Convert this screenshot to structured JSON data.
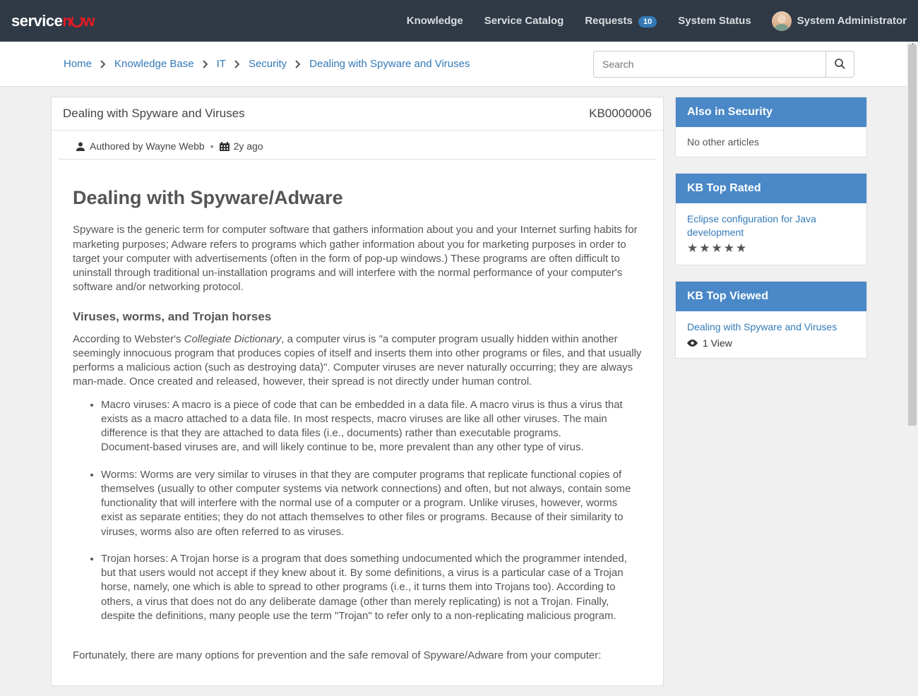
{
  "nav": {
    "knowledge": "Knowledge",
    "service_catalog": "Service Catalog",
    "requests": "Requests",
    "requests_count": "10",
    "system_status": "System Status",
    "user_name": "System Administrator"
  },
  "breadcrumb": {
    "items": [
      "Home",
      "Knowledge Base",
      "IT",
      "Security",
      "Dealing with Spyware and Viruses"
    ]
  },
  "search": {
    "placeholder": "Search"
  },
  "article": {
    "title_bar": "Dealing with Spyware and Viruses",
    "kb_id": "KB0000006",
    "author_line": "Authored by Wayne Webb",
    "age": "2y ago",
    "h1": "Dealing with Spyware/Adware",
    "intro": "Spyware is the generic term for computer software that gathers information about you and your Internet surfing habits for marketing purposes; Adware refers to programs which gather information about you for marketing purposes in order to target your computer with advertisements (often in the form of pop-up windows.) These programs are often difficult to uninstall through traditional un-installation programs and will interfere with the normal performance of your computer's software and/or networking protocol.",
    "h3": "Viruses, worms, and Trojan horses",
    "p2_a": "According to Webster's ",
    "p2_em": "Collegiate Dictionary",
    "p2_b": ", a computer virus is \"a computer program usually hidden within another seemingly innocuous program that produces copies of itself and inserts them into other programs or files, and that usually performs a malicious action (such as destroying data)\". Computer viruses are never naturally occurring; they are always man-made. Once created and released, however, their spread is not directly under human control.",
    "li1a": "Macro viruses: A macro is a piece of code that can be embedded in a data file. A macro virus is thus a virus that exists as a macro attached to a data file. In most respects, macro viruses are like all other viruses. The main difference is that they are attached to data files (i.e., documents) rather than executable programs.",
    "li1b": "Document-based viruses are, and will likely continue to be, more prevalent than any other type of virus.",
    "li2": "Worms: Worms are very similar to viruses in that they are computer programs that replicate functional copies of themselves (usually to other computer systems via network connections) and often, but not always, contain some functionality that will interfere with the normal use of a computer or a program. Unlike viruses, however, worms exist as separate entities; they do not attach themselves to other files or programs. Because of their similarity to viruses, worms also are often referred to as viruses.",
    "li3": "Trojan horses: A Trojan horse is a program that does something undocumented which the programmer intended, but that users would not accept if they knew about it. By some definitions, a virus is a particular case of a Trojan horse, namely, one which is able to spread to other programs (i.e., it turns them into Trojans too). According to others, a virus that does not do any deliberate damage (other than merely replicating) is not a Trojan. Finally, despite the definitions, many people use the term \"Trojan\" to refer only to a non-replicating malicious program.",
    "p3": "Fortunately, there are many options for prevention and the safe removal of Spyware/Adware from your computer:"
  },
  "sidebar": {
    "also_title": "Also in Security",
    "also_empty": "No other articles",
    "top_rated_title": "KB Top Rated",
    "top_rated_link": "Eclipse configuration for Java development",
    "top_rated_stars": "★★★★★",
    "top_viewed_title": "KB Top Viewed",
    "top_viewed_link": "Dealing with Spyware and Viruses",
    "top_viewed_count": "1 View"
  }
}
